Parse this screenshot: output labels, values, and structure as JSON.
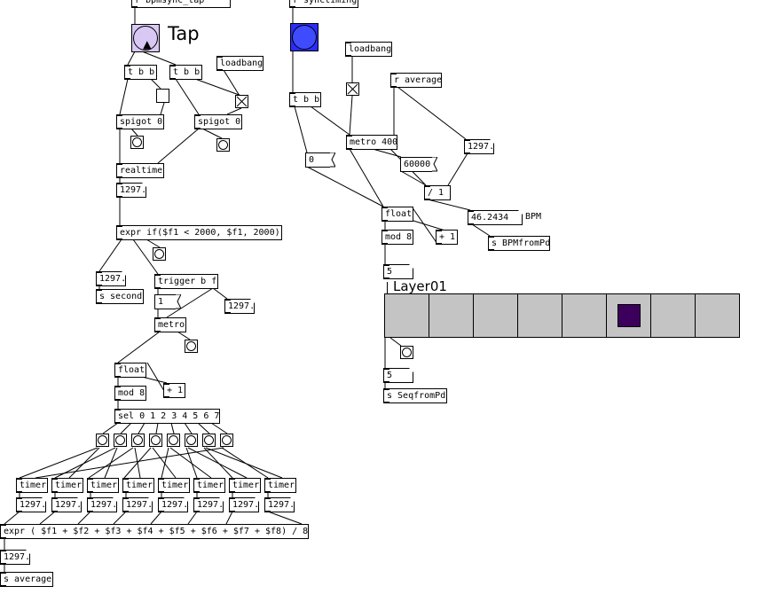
{
  "top": {
    "tap_receiver": "r bpmsync_tap",
    "sync_receiver": "r synctiming",
    "tap_label": "Tap"
  },
  "left": {
    "tbb1": "t b b",
    "tbb2": "t b b",
    "loadbang": "loadbang",
    "spigot1": "spigot 0",
    "spigot2": "spigot 0",
    "realtime": "realtime",
    "realtime_out": "1297.",
    "expr_clip": "expr if($f1 < 2000, $f1, 2000)",
    "num_second": "1297.",
    "send_second": "s second",
    "trigger": "trigger b f",
    "msg_one": "1",
    "num_trig": "1297.",
    "metro": "metro",
    "float": "float",
    "plus1": "+ 1",
    "mod8": "mod 8",
    "sel": "sel 0 1 2 3 4 5 6 7",
    "timer_labels": [
      "timer",
      "timer",
      "timer",
      "timer",
      "timer",
      "timer",
      "timer",
      "timer"
    ],
    "timer_values": [
      "1297.",
      "1297.",
      "1297.",
      "1297.",
      "1297.",
      "1297.",
      "1297.",
      "1297."
    ],
    "expr_avg": "expr ( $f1 + $f2 + $f3 + $f4 + $f5 + $f6 + $f7 + $f8) / 8",
    "avg_out": "1297.",
    "send_average": "s average"
  },
  "right": {
    "loadbang": "loadbang",
    "r_average": "r average",
    "tbb": "t b b",
    "metro400": "metro 400",
    "num_1297": "1297.",
    "msg_zero": "0",
    "num_60000": "60000",
    "div1": "/ 1",
    "float": "float",
    "plus1": "+ 1",
    "bpm_value": "46.2434",
    "bpm_label": "BPM",
    "send_bpm": "s BPMfromPd",
    "mod8": "mod 8",
    "step_top": "5",
    "layer_label": "Layer01",
    "grid_cells": 8,
    "active_cell": 5,
    "step_bottom": "5",
    "send_seq": "s SeqfromPd"
  },
  "colors": {
    "tap_bang": "#d9c8f4",
    "sync_bang": "#2a2cff",
    "grid_bg": "#c4c4c4",
    "grid_active": "#3c005c"
  }
}
